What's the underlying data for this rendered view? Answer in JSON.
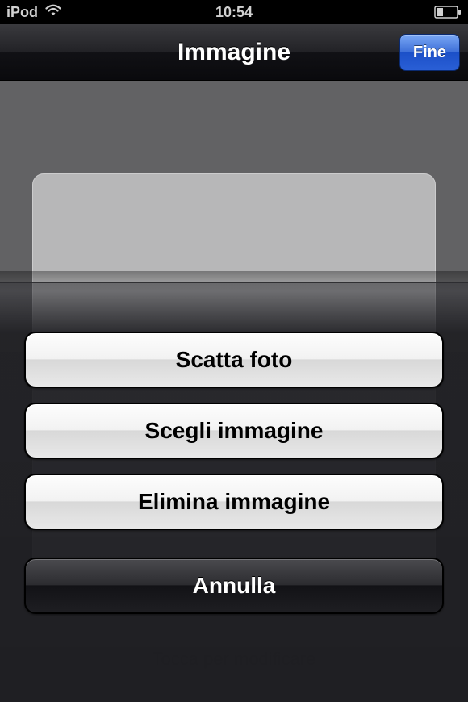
{
  "statusbar": {
    "carrier": "iPod",
    "time": "10:54"
  },
  "navbar": {
    "title": "Immagine",
    "done": "Fine"
  },
  "content": {
    "hint": "Tocca per modificare"
  },
  "actionsheet": {
    "options": [
      {
        "label": "Scatta foto"
      },
      {
        "label": "Scegli immagine"
      },
      {
        "label": "Elimina immagine"
      }
    ],
    "cancel": "Annulla"
  }
}
